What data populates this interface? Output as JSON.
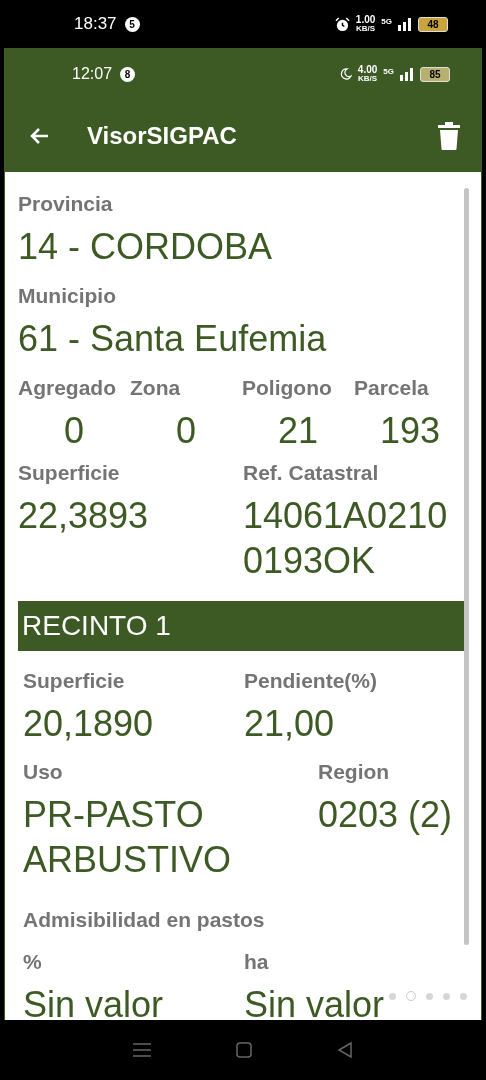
{
  "outer_status": {
    "time": "18:37",
    "notification_count": "5",
    "speed": "1.00",
    "speed_unit": "KB/S",
    "network": "5G",
    "battery": "48"
  },
  "inner_status": {
    "time": "12:07",
    "notification_count": "8",
    "speed": "4.00",
    "speed_unit": "KB/S",
    "network": "5G",
    "battery": "85"
  },
  "toolbar": {
    "title": "VisorSIGPAC"
  },
  "provincia": {
    "label": "Provincia",
    "value": "14 - CORDOBA"
  },
  "municipio": {
    "label": "Municipio",
    "value": "61 - Santa Eufemia"
  },
  "codes": [
    {
      "label": "Agregado",
      "value": "0"
    },
    {
      "label": "Zona",
      "value": "0"
    },
    {
      "label": "Poligono",
      "value": "21"
    },
    {
      "label": "Parcela",
      "value": "193"
    }
  ],
  "superficie": {
    "label": "Superficie",
    "value": "22,3893"
  },
  "ref_catastral": {
    "label": "Ref. Catastral",
    "lines": [
      "14061A0210",
      "0193OK"
    ]
  },
  "recinto": {
    "title": "RECINTO 1",
    "superficie": {
      "label": "Superficie",
      "value": "20,1890"
    },
    "pendiente": {
      "label": "Pendiente(%)",
      "value": "21,00"
    },
    "uso": {
      "label": "Uso",
      "value": "PR-PASTO ARBUSTIVO"
    },
    "region": {
      "label": "Region",
      "value": "0203 (2)"
    },
    "admisibilidad": {
      "label": "Admisibilidad en pastos"
    },
    "porcentaje": {
      "label": "%",
      "value": "Sin valor"
    },
    "hectareas": {
      "label": "ha",
      "value": "Sin valor"
    }
  },
  "page_dots": [
    {
      "selected": false
    },
    {
      "selected": true
    },
    {
      "selected": false
    },
    {
      "selected": false
    },
    {
      "selected": false
    }
  ]
}
